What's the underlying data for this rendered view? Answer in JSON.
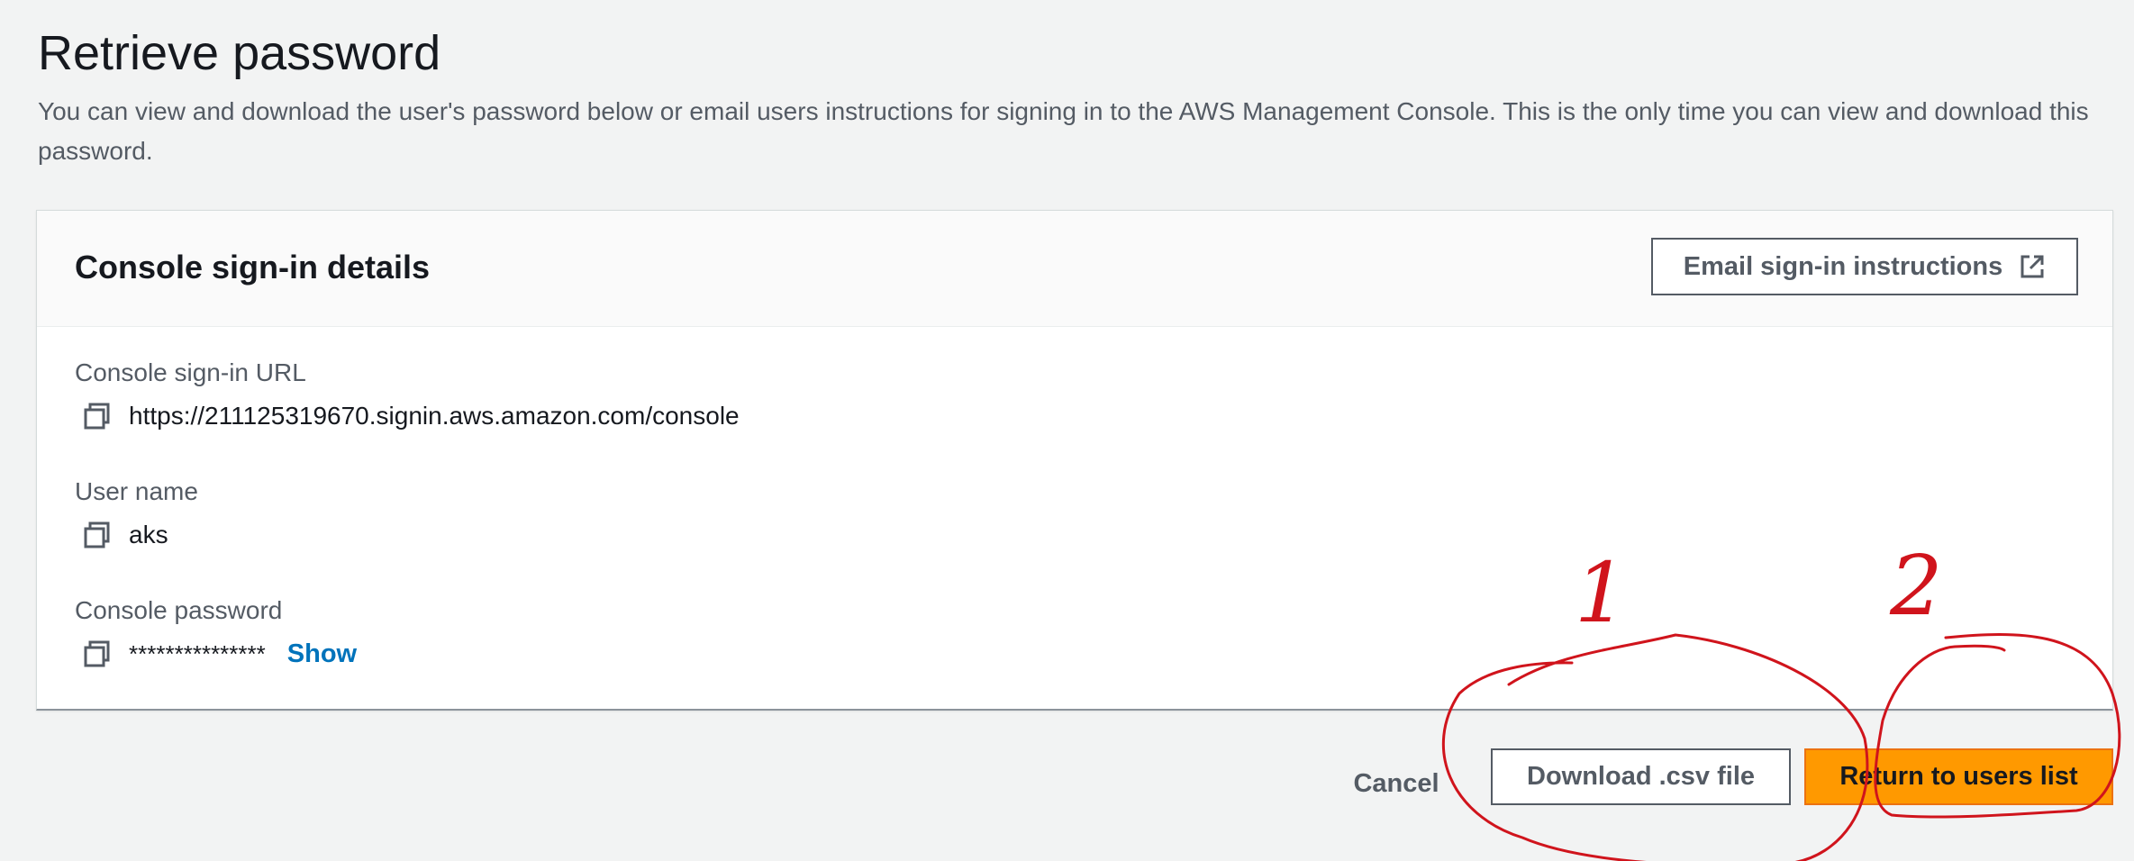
{
  "page": {
    "title": "Retrieve password",
    "description": "You can view and download the user's password below or email users instructions for signing in to the AWS Management Console. This is the only time you can view and download this password."
  },
  "panel": {
    "title": "Console sign-in details",
    "email_button": {
      "label": "Email sign-in instructions",
      "icon": "external-link-icon"
    },
    "fields": [
      {
        "label": "Console sign-in URL",
        "value": "https://211125319670.signin.aws.amazon.com/console",
        "icon": "copy-icon"
      },
      {
        "label": "User name",
        "value": "aks",
        "icon": "copy-icon"
      },
      {
        "label": "Console password",
        "value": "***************",
        "icon": "copy-icon",
        "show_label": "Show"
      }
    ]
  },
  "footer": {
    "cancel_label": "Cancel",
    "download_label": "Download .csv file",
    "return_label": "Return to users list"
  },
  "annotations": {
    "marks": [
      "1",
      "2"
    ],
    "color": "#d0141c"
  },
  "colors": {
    "primary": "#ff9900",
    "link": "#0073bb",
    "background": "#f2f3f3"
  }
}
